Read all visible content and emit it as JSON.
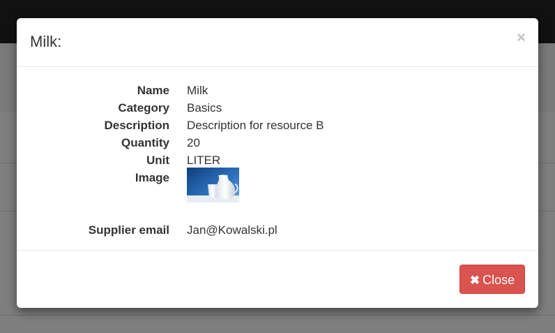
{
  "modal": {
    "title": "Milk:",
    "close_x": "×",
    "details": [
      {
        "label": "Name",
        "value": "Milk"
      },
      {
        "label": "Category",
        "value": "Basics"
      },
      {
        "label": "Description",
        "value": "Description for resource B"
      },
      {
        "label": "Quantity",
        "value": "20"
      },
      {
        "label": "Unit",
        "value": "LITER"
      },
      {
        "label": "Image",
        "value": ""
      },
      {
        "label": "Supplier email",
        "value": "Jan@Kowalski.pl"
      }
    ],
    "image_icon": "milk-jugs-photo",
    "footer": {
      "close_icon": "✖",
      "close_label": "Close"
    }
  },
  "colors": {
    "danger": "#d9534f",
    "topbar": "#222222",
    "backdrop": "rgba(0,0,0,0.5)"
  }
}
